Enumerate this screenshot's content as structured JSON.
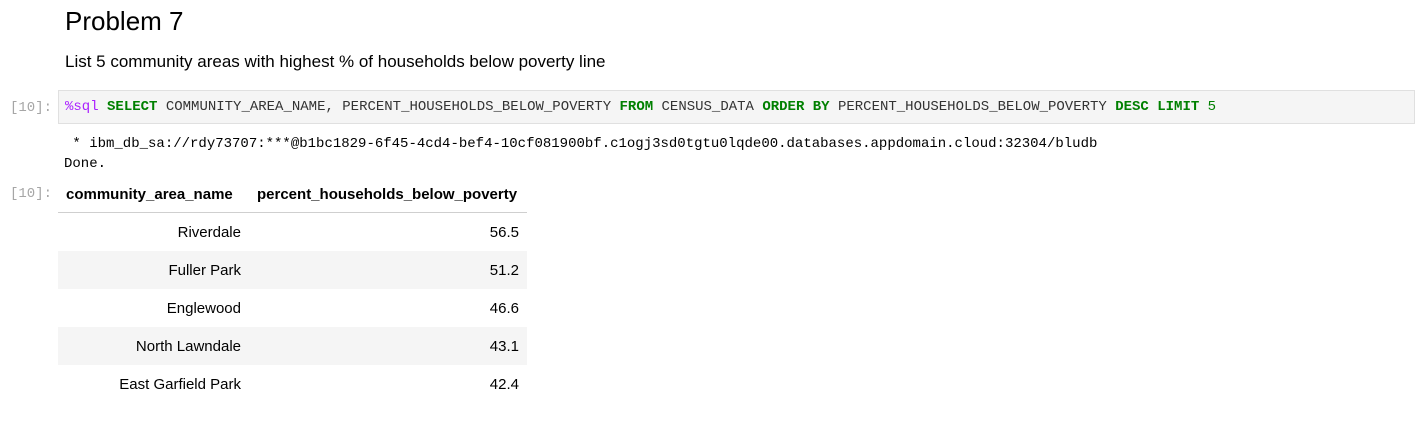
{
  "markdown": {
    "title": "Problem 7",
    "subtitle": "List 5 community areas with highest % of households below poverty line"
  },
  "cell": {
    "in_prompt": "[10]:",
    "out_prompt": "[10]:",
    "code_tokens": [
      {
        "type": "magic",
        "text": "%sql"
      },
      {
        "type": "text",
        "text": " "
      },
      {
        "type": "kw",
        "text": "SELECT"
      },
      {
        "type": "text",
        "text": " COMMUNITY_AREA_NAME, PERCENT_HOUSEHOLDS_BELOW_POVERTY "
      },
      {
        "type": "kw",
        "text": "FROM"
      },
      {
        "type": "text",
        "text": " CENSUS_DATA "
      },
      {
        "type": "kw",
        "text": "ORDER BY"
      },
      {
        "type": "text",
        "text": " PERCENT_HOUSEHOLDS_BELOW_POVERTY "
      },
      {
        "type": "kw",
        "text": "DESC"
      },
      {
        "type": "text",
        "text": " "
      },
      {
        "type": "kw",
        "text": "LIMIT"
      },
      {
        "type": "text",
        "text": " "
      },
      {
        "type": "num",
        "text": "5"
      }
    ],
    "output": {
      "connection_line": " * ibm_db_sa://rdy73707:***@b1bc1829-6f45-4cd4-bef4-10cf081900bf.c1ogj3sd0tgtu0lqde00.databases.appdomain.cloud:32304/bludb",
      "status": "Done.",
      "table": {
        "columns": [
          "community_area_name",
          "percent_households_below_poverty"
        ],
        "rows": [
          [
            "Riverdale",
            "56.5"
          ],
          [
            "Fuller Park",
            "51.2"
          ],
          [
            "Englewood",
            "46.6"
          ],
          [
            "North Lawndale",
            "43.1"
          ],
          [
            "East Garfield Park",
            "42.4"
          ]
        ]
      }
    }
  }
}
